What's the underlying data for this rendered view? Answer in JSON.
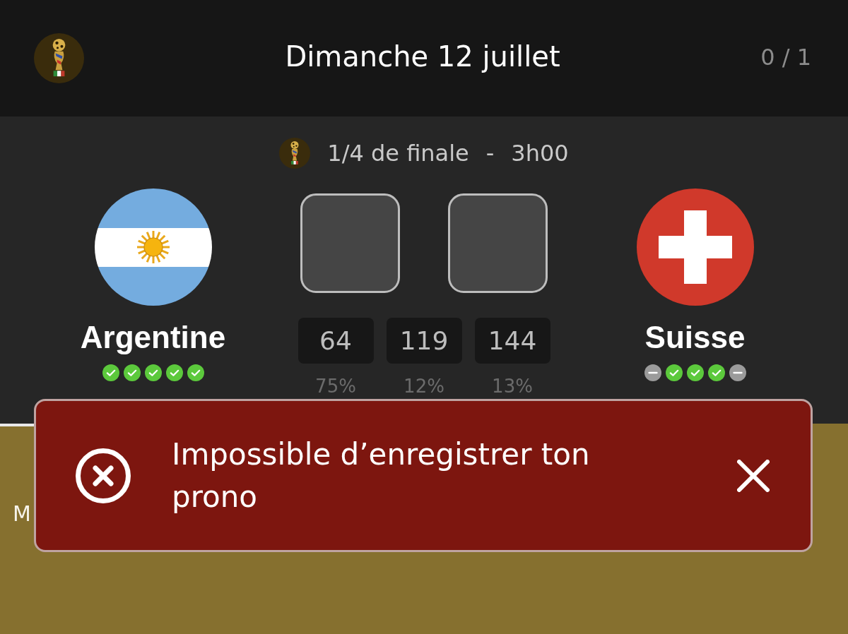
{
  "header": {
    "title": "Dimanche 12 juillet",
    "progress": "0 / 1"
  },
  "match": {
    "stage": "1/4 de finale",
    "separator": "-",
    "kickoff": "3h00",
    "home": {
      "name": "Argentine",
      "kind": "argentina",
      "form": [
        {
          "kind": "win"
        },
        {
          "kind": "win"
        },
        {
          "kind": "win"
        },
        {
          "kind": "win"
        },
        {
          "kind": "win"
        }
      ]
    },
    "away": {
      "name": "Suisse",
      "kind": "switzerland",
      "form": [
        {
          "kind": "draw"
        },
        {
          "kind": "win"
        },
        {
          "kind": "win"
        },
        {
          "kind": "win"
        },
        {
          "kind": "draw"
        }
      ]
    },
    "odds": [
      {
        "votes": "64",
        "share": "75%"
      },
      {
        "votes": "119",
        "share": "12%"
      },
      {
        "votes": "144",
        "share": "13%"
      }
    ]
  },
  "content": {
    "text": "M"
  },
  "toast": {
    "kind": "error",
    "message": "Impossible d’enregistrer ton prono"
  }
}
